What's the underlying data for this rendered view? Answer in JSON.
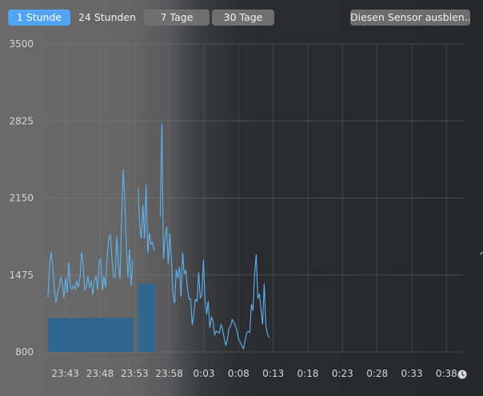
{
  "tabs": [
    {
      "label": "1 Stunde",
      "active": true
    },
    {
      "label": "24 Stunden",
      "active": false
    },
    {
      "label": "7 Tage",
      "active": false
    },
    {
      "label": "30 Tage",
      "active": false
    }
  ],
  "hide_sensor_label": "Diesen Sensor ausblen...",
  "clock_icon": "clock-icon",
  "colors": {
    "line": "#5fb3f0",
    "fill": "#2f6690",
    "grid": "#8a8a8a",
    "accent": "#4fa4f6"
  },
  "chart_data": {
    "type": "area",
    "ylim": [
      800,
      3500
    ],
    "yticks": [
      "3500",
      "2825",
      "2150",
      "1475",
      "800"
    ],
    "xticks": [
      "23:43",
      "23:48",
      "23:53",
      "23:58",
      "0:03",
      "0:08",
      "0:13",
      "0:18",
      "0:23",
      "0:28",
      "0:33",
      "0:38"
    ],
    "grid": true,
    "gaps": [
      [
        0.2067,
        0.2167
      ],
      [
        0.2583,
        0.27
      ]
    ],
    "series": [
      {
        "segments": [
          {
            "x0": 0.0,
            "x1": 0.2067,
            "baseline": 1100,
            "peaks": [
              [
                0.0,
                1350
              ],
              [
                0.005,
                2200
              ],
              [
                0.012,
                1500
              ],
              [
                0.02,
                1300
              ],
              [
                0.03,
                1550
              ],
              [
                0.04,
                1400
              ],
              [
                0.05,
                1600
              ],
              [
                0.06,
                1350
              ],
              [
                0.07,
                1550
              ],
              [
                0.08,
                1700
              ],
              [
                0.09,
                1400
              ],
              [
                0.1,
                1600
              ],
              [
                0.11,
                1500
              ],
              [
                0.12,
                1450
              ],
              [
                0.125,
                2050
              ],
              [
                0.13,
                1500
              ],
              [
                0.14,
                1550
              ],
              [
                0.15,
                1950
              ],
              [
                0.155,
                1750
              ],
              [
                0.16,
                1600
              ],
              [
                0.165,
                2000
              ],
              [
                0.17,
                1500
              ],
              [
                0.175,
                2050
              ],
              [
                0.18,
                2450
              ],
              [
                0.19,
                1800
              ],
              [
                0.2,
                1700
              ]
            ]
          },
          {
            "x0": 0.2167,
            "x1": 0.2583,
            "baseline": 1400,
            "peaks": [
              [
                0.2167,
                3250
              ],
              [
                0.222,
                1700
              ],
              [
                0.228,
                2100
              ],
              [
                0.235,
                2350
              ],
              [
                0.24,
                1900
              ],
              [
                0.245,
                2000
              ],
              [
                0.25,
                1800
              ]
            ]
          },
          {
            "x0": 0.27,
            "x1": 0.535,
            "baseline": 800,
            "peaks": [
              [
                0.27,
                2400
              ],
              [
                0.275,
                3250
              ],
              [
                0.28,
                1900
              ],
              [
                0.29,
                1900
              ],
              [
                0.3,
                1700
              ],
              [
                0.31,
                1600
              ],
              [
                0.32,
                1750
              ],
              [
                0.33,
                1550
              ],
              [
                0.34,
                1400
              ],
              [
                0.35,
                1250
              ],
              [
                0.36,
                1500
              ],
              [
                0.37,
                1800
              ],
              [
                0.38,
                1300
              ],
              [
                0.39,
                1200
              ],
              [
                0.4,
                1050
              ],
              [
                0.41,
                1100
              ],
              [
                0.42,
                1000
              ],
              [
                0.43,
                900
              ],
              [
                0.44,
                1100
              ],
              [
                0.45,
                1050
              ],
              [
                0.46,
                900
              ],
              [
                0.47,
                850
              ],
              [
                0.48,
                1000
              ],
              [
                0.49,
                1300
              ],
              [
                0.5,
                2200
              ],
              [
                0.51,
                1200
              ],
              [
                0.52,
                1400
              ],
              [
                0.53,
                1000
              ]
            ]
          }
        ]
      }
    ]
  }
}
